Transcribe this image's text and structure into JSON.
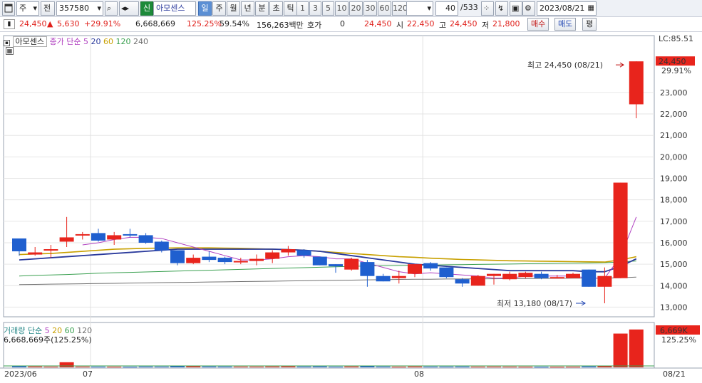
{
  "toolbar": {
    "type_label": "주",
    "prev_label": "전",
    "code": "357580",
    "badge": "신",
    "name": "아모센스",
    "periods": [
      "일",
      "주",
      "월",
      "년",
      "분",
      "초",
      "틱"
    ],
    "active_period": "일",
    "minutes": [
      "1",
      "3",
      "5",
      "10",
      "20",
      "30",
      "60",
      "120"
    ],
    "count": "40",
    "total": "/533",
    "date": "2023/08/21"
  },
  "quote": {
    "price": "24,450",
    "change": "5,630",
    "change_rate": "+29.91%",
    "volume": "6,668,669",
    "volume_rate": "125.25%",
    "turnover_rate": "59.54%",
    "amount": "156,263백만",
    "hoga_label": "호가",
    "hoga": "0",
    "hoga_price": "24,450",
    "open_label": "시",
    "open": "22,450",
    "high_label": "고",
    "high": "24,450",
    "low_label": "저",
    "low": "21,800",
    "buy_label": "매수",
    "sell_label": "매도",
    "eval_label": "평"
  },
  "price_panel": {
    "stock_name": "아모센스",
    "ma_label": "종가 단순",
    "ma_periods": [
      "5",
      "20",
      "60",
      "120",
      "240"
    ],
    "ma_colors": [
      "#b040c0",
      "#2a3a9c",
      "#c8a000",
      "#3aa050",
      "#707070"
    ],
    "lc_label": "LC:85.51",
    "last_price_box": "24,450",
    "last_rate": "29.91%",
    "high_annot": "최고 24,450 (08/21)",
    "low_annot": "최저 13,180 (08/17)"
  },
  "volume_panel": {
    "label": "거래량",
    "ma_label": "단순",
    "ma_periods": [
      "5",
      "20",
      "60",
      "120"
    ],
    "volume_text": "6,668,669주(125.25%)",
    "last_box": "6,669K",
    "last_rate": "125.25%"
  },
  "chart_data": {
    "type": "candlestick",
    "y_ticks": [
      13000,
      14000,
      15000,
      16000,
      17000,
      18000,
      19000,
      20000,
      21000,
      22000,
      23000
    ],
    "ylim": [
      12550,
      25650
    ],
    "x_tick_labels": [
      "2023/06",
      "07",
      "08",
      "08/21"
    ],
    "candles": [
      {
        "o": 16200,
        "c": 15600,
        "h": 16200,
        "l": 15400
      },
      {
        "o": 15450,
        "c": 15550,
        "h": 15800,
        "l": 15400
      },
      {
        "o": 15650,
        "c": 15700,
        "h": 15900,
        "l": 15300
      },
      {
        "o": 16050,
        "c": 16250,
        "h": 17200,
        "l": 15800
      },
      {
        "o": 16350,
        "c": 16400,
        "h": 16500,
        "l": 16150
      },
      {
        "o": 16450,
        "c": 16100,
        "h": 16650,
        "l": 16050
      },
      {
        "o": 16150,
        "c": 16350,
        "h": 16500,
        "l": 15900
      },
      {
        "o": 16400,
        "c": 16350,
        "h": 16650,
        "l": 16250
      },
      {
        "o": 16350,
        "c": 16000,
        "h": 16450,
        "l": 15950
      },
      {
        "o": 16050,
        "c": 15650,
        "h": 16100,
        "l": 15550
      },
      {
        "o": 15650,
        "c": 15050,
        "h": 15650,
        "l": 14950
      },
      {
        "o": 15050,
        "c": 15300,
        "h": 15450,
        "l": 15000
      },
      {
        "o": 15350,
        "c": 15200,
        "h": 15600,
        "l": 15100
      },
      {
        "o": 15300,
        "c": 15100,
        "h": 15350,
        "l": 15000
      },
      {
        "o": 15100,
        "c": 15150,
        "h": 15300,
        "l": 15000
      },
      {
        "o": 15150,
        "c": 15250,
        "h": 15450,
        "l": 14950
      },
      {
        "o": 15250,
        "c": 15550,
        "h": 15650,
        "l": 15050
      },
      {
        "o": 15550,
        "c": 15700,
        "h": 15850,
        "l": 15400
      },
      {
        "o": 15650,
        "c": 15400,
        "h": 15700,
        "l": 15300
      },
      {
        "o": 15350,
        "c": 14950,
        "h": 15350,
        "l": 14950
      },
      {
        "o": 15000,
        "c": 14900,
        "h": 15000,
        "l": 14600
      },
      {
        "o": 14750,
        "c": 15250,
        "h": 15300,
        "l": 14700
      },
      {
        "o": 15100,
        "c": 14450,
        "h": 15200,
        "l": 13950
      },
      {
        "o": 14450,
        "c": 14200,
        "h": 14550,
        "l": 14200
      },
      {
        "o": 14350,
        "c": 14450,
        "h": 14700,
        "l": 14100
      },
      {
        "o": 14550,
        "c": 15000,
        "h": 15000,
        "l": 14400
      },
      {
        "o": 15050,
        "c": 14800,
        "h": 15100,
        "l": 14700
      },
      {
        "o": 14850,
        "c": 14400,
        "h": 14850,
        "l": 14350
      },
      {
        "o": 14300,
        "c": 14100,
        "h": 14350,
        "l": 13950
      },
      {
        "o": 14000,
        "c": 14450,
        "h": 14500,
        "l": 14000
      },
      {
        "o": 14450,
        "c": 14550,
        "h": 14550,
        "l": 14050
      },
      {
        "o": 14300,
        "c": 14550,
        "h": 14650,
        "l": 14250
      },
      {
        "o": 14400,
        "c": 14600,
        "h": 14650,
        "l": 14350
      },
      {
        "o": 14550,
        "c": 14350,
        "h": 14650,
        "l": 14300
      },
      {
        "o": 14350,
        "c": 14400,
        "h": 14500,
        "l": 14350
      },
      {
        "o": 14350,
        "c": 14550,
        "h": 14600,
        "l": 14350
      },
      {
        "o": 14750,
        "c": 13950,
        "h": 14750,
        "l": 13950
      },
      {
        "o": 13950,
        "c": 14450,
        "h": 14850,
        "l": 13180
      },
      {
        "o": 14350,
        "c": 18800,
        "h": 18800,
        "l": 14350
      },
      {
        "o": 22450,
        "c": 24450,
        "h": 24450,
        "l": 21800
      }
    ],
    "ma5": [
      null,
      null,
      null,
      null,
      15900,
      16000,
      16150,
      16250,
      16250,
      16200,
      16000,
      15800,
      15600,
      15400,
      15200,
      15200,
      15250,
      15350,
      15400,
      15350,
      15250,
      15250,
      15050,
      14850,
      14650,
      14550,
      14600,
      14550,
      14500,
      14450,
      14350,
      14350,
      14450,
      14450,
      14450,
      14450,
      14350,
      14350,
      15350,
      17200
    ],
    "ma20": [
      15200,
      15250,
      15300,
      15350,
      15400,
      15450,
      15500,
      15550,
      15600,
      15650,
      15700,
      15700,
      15700,
      15700,
      15700,
      15700,
      15700,
      15680,
      15650,
      15600,
      15500,
      15400,
      15300,
      15200,
      15100,
      15000,
      14950,
      14900,
      14850,
      14800,
      14750,
      14700,
      14700,
      14700,
      14700,
      14700,
      14650,
      14650,
      14900,
      15250
    ],
    "ma60": [
      15450,
      15480,
      15500,
      15550,
      15600,
      15650,
      15700,
      15720,
      15740,
      15750,
      15760,
      15760,
      15760,
      15750,
      15740,
      15720,
      15700,
      15680,
      15650,
      15600,
      15550,
      15500,
      15450,
      15400,
      15350,
      15320,
      15280,
      15250,
      15220,
      15200,
      15180,
      15160,
      15150,
      15140,
      15130,
      15120,
      15110,
      15100,
      15200,
      15350
    ],
    "ma120": [
      14450,
      14480,
      14500,
      14520,
      14550,
      14580,
      14600,
      14620,
      14640,
      14660,
      14680,
      14700,
      14720,
      14740,
      14760,
      14780,
      14800,
      14820,
      14840,
      14860,
      14880,
      14900,
      14920,
      14930,
      14940,
      14950,
      14960,
      14970,
      14980,
      14990,
      15000,
      15010,
      15020,
      15030,
      15040,
      15050,
      15060,
      15070,
      15100,
      15150
    ],
    "ma240": [
      14050,
      14060,
      14070,
      14080,
      14090,
      14100,
      14110,
      14120,
      14130,
      14140,
      14150,
      14160,
      14170,
      14180,
      14190,
      14200,
      14210,
      14220,
      14230,
      14240,
      14250,
      14260,
      14270,
      14280,
      14290,
      14300,
      14300,
      14310,
      14310,
      14320,
      14320,
      14330,
      14330,
      14340,
      14340,
      14350,
      14350,
      14350,
      14370,
      14400
    ],
    "volume": [
      180,
      150,
      120,
      900,
      130,
      120,
      110,
      100,
      140,
      130,
      260,
      180,
      150,
      140,
      130,
      130,
      150,
      170,
      140,
      160,
      120,
      150,
      230,
      140,
      110,
      150,
      130,
      130,
      140,
      120,
      130,
      120,
      110,
      100,
      100,
      110,
      160,
      230,
      5950,
      6669
    ],
    "volume_ymax": 7400
  }
}
